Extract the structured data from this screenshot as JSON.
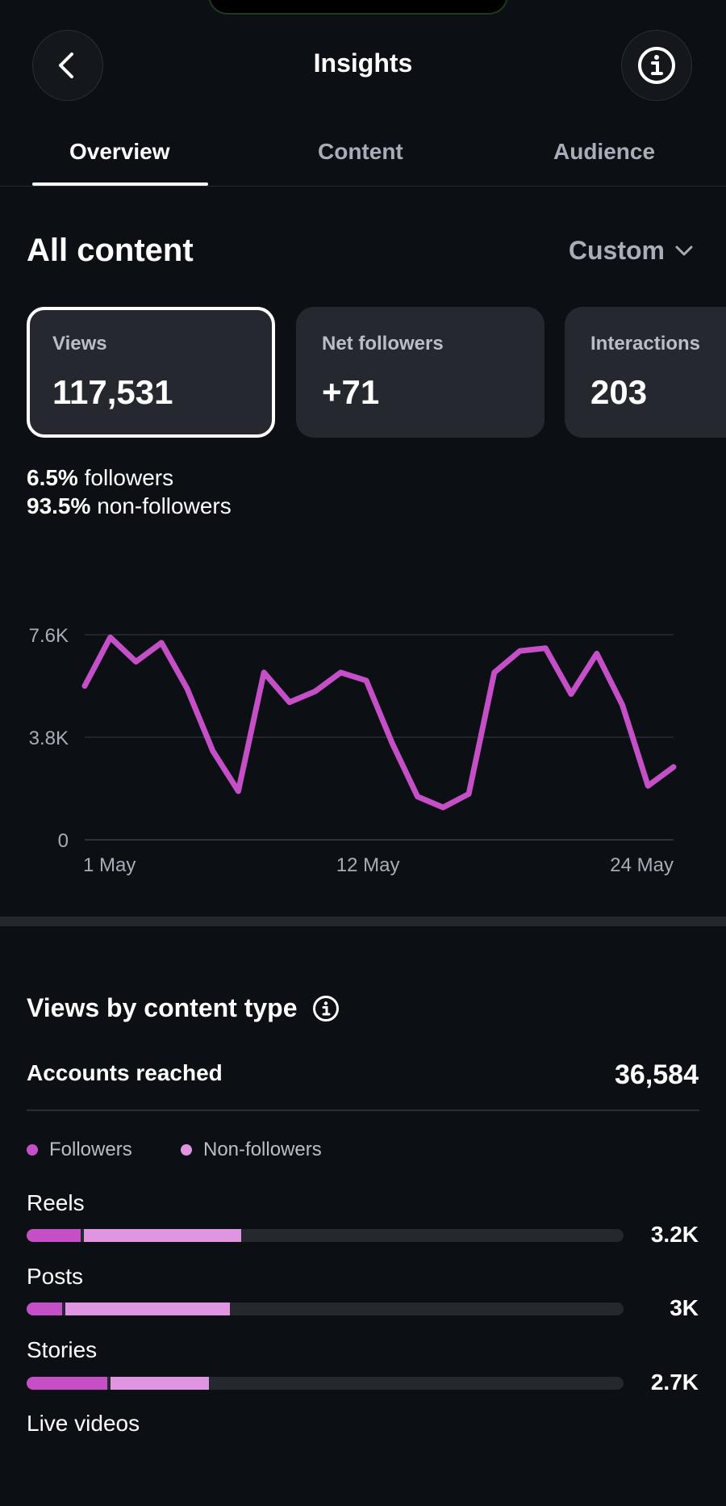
{
  "header": {
    "title": "Insights",
    "back_icon": "chevron-left-icon",
    "info_icon": "info-icon"
  },
  "tabs": [
    {
      "label": "Overview",
      "active": true
    },
    {
      "label": "Content",
      "active": false
    },
    {
      "label": "Audience",
      "active": false
    }
  ],
  "overview": {
    "section_title": "All content",
    "range_selector": "Custom",
    "cards": [
      {
        "label": "Views",
        "value": "117,531"
      },
      {
        "label": "Net followers",
        "value": "+71"
      },
      {
        "label": "Interactions",
        "value": "203"
      }
    ],
    "followers_pct": "6.5%",
    "followers_text": "followers",
    "non_followers_pct": "93.5%",
    "non_followers_text": "non-followers"
  },
  "chart_data": {
    "type": "line",
    "x": [
      "1 May",
      "2 May",
      "3 May",
      "4 May",
      "5 May",
      "6 May",
      "7 May",
      "8 May",
      "9 May",
      "10 May",
      "11 May",
      "12 May",
      "13 May",
      "14 May",
      "15 May",
      "16 May",
      "17 May",
      "18 May",
      "19 May",
      "20 May",
      "21 May",
      "22 May",
      "23 May",
      "24 May"
    ],
    "values": [
      5700,
      7500,
      6600,
      7300,
      5600,
      3300,
      1800,
      6200,
      5100,
      5500,
      6200,
      5900,
      3600,
      1600,
      1200,
      1700,
      6200,
      7000,
      7100,
      5400,
      6900,
      5000,
      2000,
      2700
    ],
    "ylim": [
      0,
      7600
    ],
    "yticks": [
      "7.6K",
      "3.8K",
      "0"
    ],
    "ytick_values": [
      7600,
      3800,
      0
    ],
    "xticks": [
      "1 May",
      "12 May",
      "24 May"
    ],
    "xtick_indices": [
      0,
      11,
      23
    ],
    "grid": true,
    "color": "#c44fc7"
  },
  "content_type": {
    "title": "Views by content type",
    "reach_label": "Accounts reached",
    "reach_value": "36,584",
    "legend": [
      {
        "label": "Followers",
        "color": "#c44fc7"
      },
      {
        "label": "Non-followers",
        "color": "#df95e0"
      }
    ],
    "bars": [
      {
        "label": "Reels",
        "value": "3.2K",
        "followers_frac": 0.09,
        "non_followers_frac": 0.27
      },
      {
        "label": "Posts",
        "value": "3K",
        "followers_frac": 0.06,
        "non_followers_frac": 0.28
      },
      {
        "label": "Stories",
        "value": "2.7K",
        "followers_frac": 0.135,
        "non_followers_frac": 0.17
      },
      {
        "label": "Live videos",
        "value": "",
        "followers_frac": 0,
        "non_followers_frac": 0
      }
    ]
  },
  "colors": {
    "background": "#0c0f14",
    "card": "#25282f",
    "accent": "#c44fc7",
    "accent_light": "#df95e0",
    "muted_text": "#a8adb7"
  }
}
